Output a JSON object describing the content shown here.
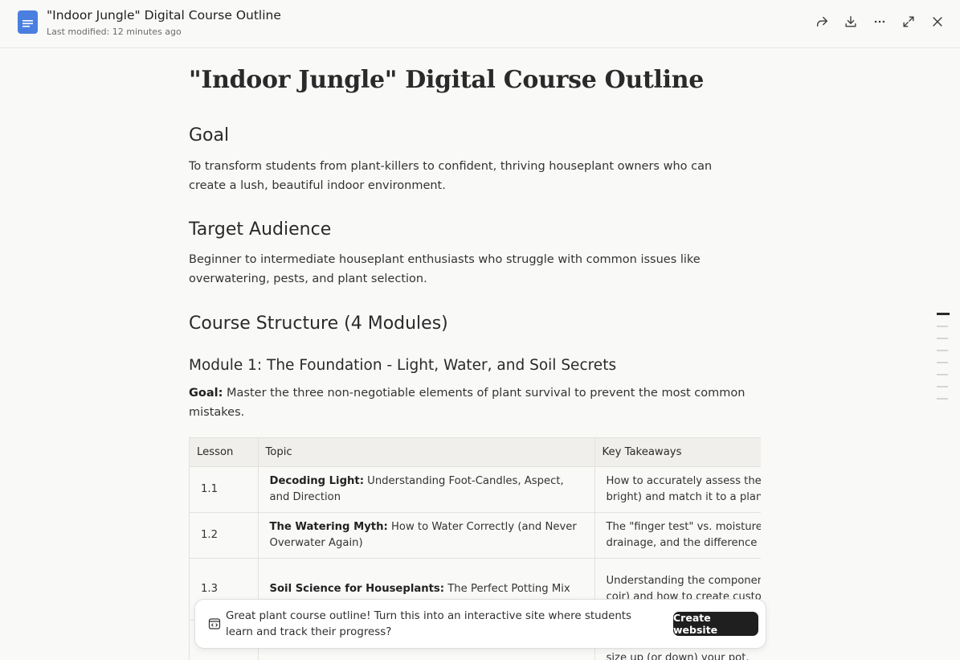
{
  "header": {
    "title": "\"Indoor Jungle\" Digital Course Outline",
    "last_modified": "Last modified: 12 minutes ago",
    "icons": [
      "share-icon",
      "download-icon",
      "more-icon",
      "expand-icon",
      "close-icon"
    ]
  },
  "document": {
    "title": "\"Indoor Jungle\" Digital Course Outline",
    "goal_heading": "Goal",
    "goal_text": "To transform students from plant-killers to confident, thriving houseplant owners who can create a lush, beautiful indoor environment.",
    "audience_heading": "Target Audience",
    "audience_text": "Beginner to intermediate houseplant enthusiasts who struggle with common issues like overwatering, pests, and plant selection.",
    "structure_heading": "Course Structure (4 Modules)",
    "module1_heading": "Module 1: The Foundation - Light, Water, and Soil Secrets",
    "module1_goal_label": "Goal:",
    "module1_goal_text": " Master the three non-negotiable elements of plant survival to prevent the most common mistakes.",
    "table": {
      "headers": [
        "Lesson",
        "Topic",
        "Key Takeaways"
      ],
      "rows": [
        {
          "lesson": "1.1",
          "topic_bold": "Decoding Light:",
          "topic_rest": " Understanding Foot-Candles, Aspect, and Direction",
          "takeaway_line1": "How to accurately assess the lig",
          "takeaway_line2": "bright) and match it to a plant's"
        },
        {
          "lesson": "1.2",
          "topic_bold": "The Watering Myth:",
          "topic_rest": " How to Water Correctly (and Never Overwater Again)",
          "takeaway_line1": "The \"finger test\" vs. moisture me",
          "takeaway_line2": "drainage, and the difference bet"
        },
        {
          "lesson": "1.3",
          "topic_bold": "Soil Science for Houseplants:",
          "topic_rest": " The Perfect Potting Mix",
          "takeaway_line1": "Understanding the components",
          "takeaway_line2": "coir) and how to create custom"
        },
        {
          "lesson": "",
          "topic_bold": "",
          "topic_rest": "",
          "takeaway_line1": "size up (or down) your pot.",
          "takeaway_line2": ""
        }
      ]
    }
  },
  "suggestion": {
    "text": "Great plant course outline! Turn this into an interactive site where students learn and track their progress?",
    "button_label": "Create website"
  }
}
